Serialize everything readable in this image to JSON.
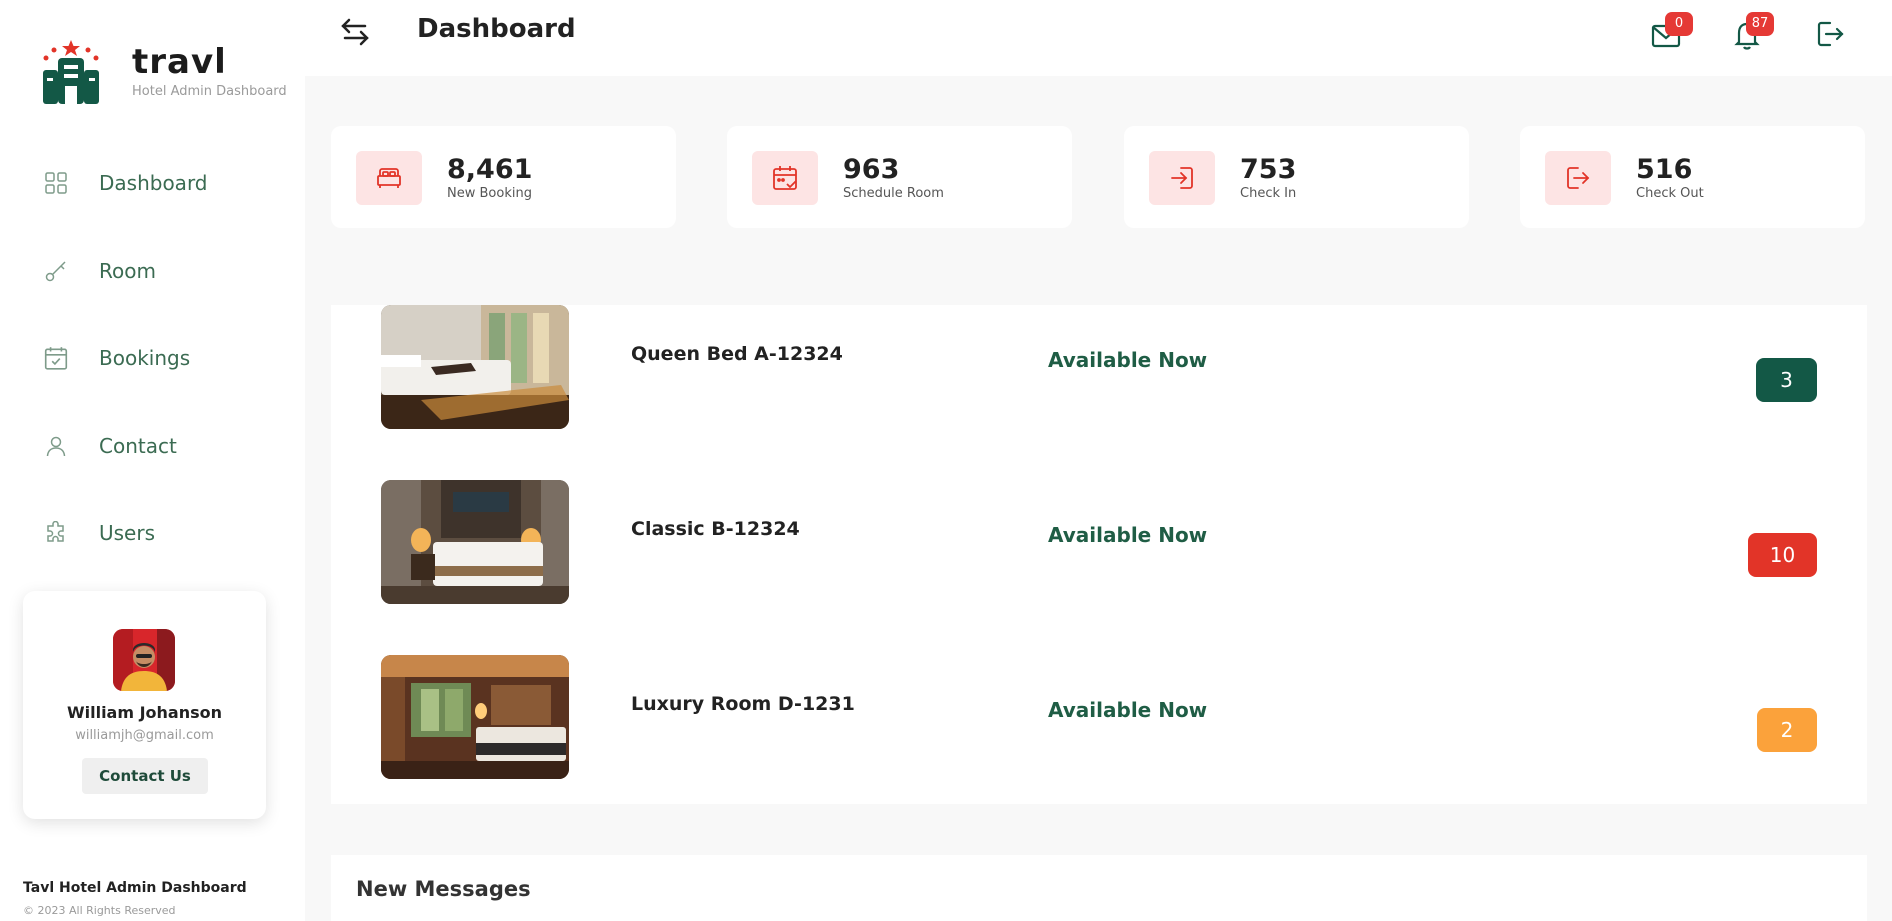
{
  "brand": {
    "name": "travl",
    "subtitle": "Hotel Admin Dashboard"
  },
  "sidebar": {
    "items": [
      {
        "label": "Dashboard",
        "icon": "grid-icon"
      },
      {
        "label": "Room",
        "icon": "key-icon"
      },
      {
        "label": "Bookings",
        "icon": "calendar-check-icon"
      },
      {
        "label": "Contact",
        "icon": "user-icon"
      },
      {
        "label": "Users",
        "icon": "puzzle-icon"
      }
    ]
  },
  "profile": {
    "name": "William Johanson",
    "email": "williamjh@gmail.com",
    "button_label": "Contact Us"
  },
  "footer": {
    "title": "Tavl Hotel Admin Dashboard",
    "copyright": "© 2023 All Rights Reserved"
  },
  "header": {
    "title": "Dashboard",
    "mail_count": "0",
    "notification_count": "87"
  },
  "stats": [
    {
      "value": "8,461",
      "label": "New Booking",
      "icon": "bed-icon"
    },
    {
      "value": "963",
      "label": "Schedule Room",
      "icon": "calendar-check-icon"
    },
    {
      "value": "753",
      "label": "Check In",
      "icon": "sign-in-icon"
    },
    {
      "value": "516",
      "label": "Check Out",
      "icon": "sign-out-icon"
    }
  ],
  "rooms": [
    {
      "name": "Queen Bed A-12324",
      "status": "Available Now",
      "count": "3",
      "count_color": "#135846"
    },
    {
      "name": "Classic B-12324",
      "status": "Available Now",
      "count": "10",
      "count_color": "#e23428"
    },
    {
      "name": "Luxury Room D-1231",
      "status": "Available Now",
      "count": "2",
      "count_color": "#fba23b"
    }
  ],
  "messages": {
    "title": "New Messages"
  },
  "colors": {
    "brand_green": "#135846",
    "accent_red": "#e23428",
    "icon_bg": "#fde4e4"
  }
}
